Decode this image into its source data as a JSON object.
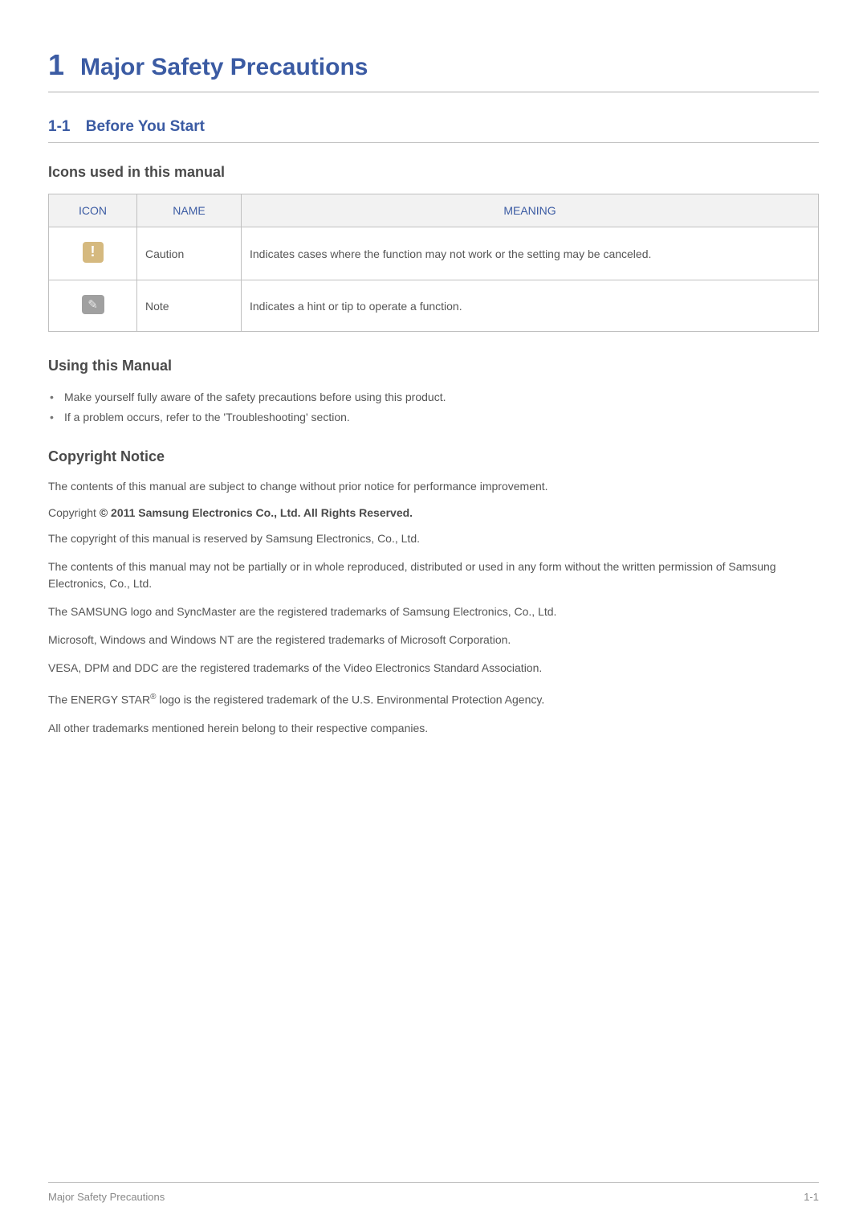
{
  "chapter": {
    "number": "1",
    "title": "Major Safety Precautions"
  },
  "section": {
    "number": "1-1",
    "title": "Before You Start"
  },
  "icons_section": {
    "heading": "Icons used in this manual",
    "table": {
      "headers": {
        "icon": "ICON",
        "name": "NAME",
        "meaning": "MEANING"
      },
      "rows": [
        {
          "icon_semantic": "caution-icon",
          "name": "Caution",
          "meaning": "Indicates cases where the function may not work or the setting may be canceled."
        },
        {
          "icon_semantic": "note-icon",
          "name": "Note",
          "meaning": "Indicates a hint or tip to operate a function."
        }
      ]
    }
  },
  "using_manual": {
    "heading": "Using this Manual",
    "bullets": [
      "Make yourself fully aware of the safety precautions before using this product.",
      "If a problem occurs, refer to the 'Troubleshooting' section."
    ]
  },
  "copyright": {
    "heading": "Copyright Notice",
    "intro": "The contents of this manual are subject to change without prior notice for performance improvement.",
    "copyright_prefix": "Copyright ",
    "copyright_symbol": "©",
    "copyright_text": "  2011 Samsung Electronics Co., Ltd. All Rights Reserved.",
    "paragraphs": [
      "The copyright of this manual is reserved by Samsung Electronics, Co., Ltd.",
      "The contents of this manual may not be partially or in whole reproduced, distributed or used in any form without the written permission of Samsung Electronics, Co., Ltd.",
      "The SAMSUNG logo and SyncMaster are the registered trademarks of Samsung Electronics, Co., Ltd.",
      "Microsoft, Windows and Windows NT are the registered trademarks of Microsoft Corporation.",
      "VESA, DPM and DDC are the registered trademarks of the Video Electronics Standard Association."
    ],
    "energy_star_pre": "The ENERGY STAR",
    "energy_star_sup": "®",
    "energy_star_post": " logo is the registered trademark of the U.S. Environmental Protection Agency.",
    "trailing": "All other trademarks mentioned herein belong to their respective companies."
  },
  "footer": {
    "left": "Major Safety Precautions",
    "right": "1-1"
  }
}
